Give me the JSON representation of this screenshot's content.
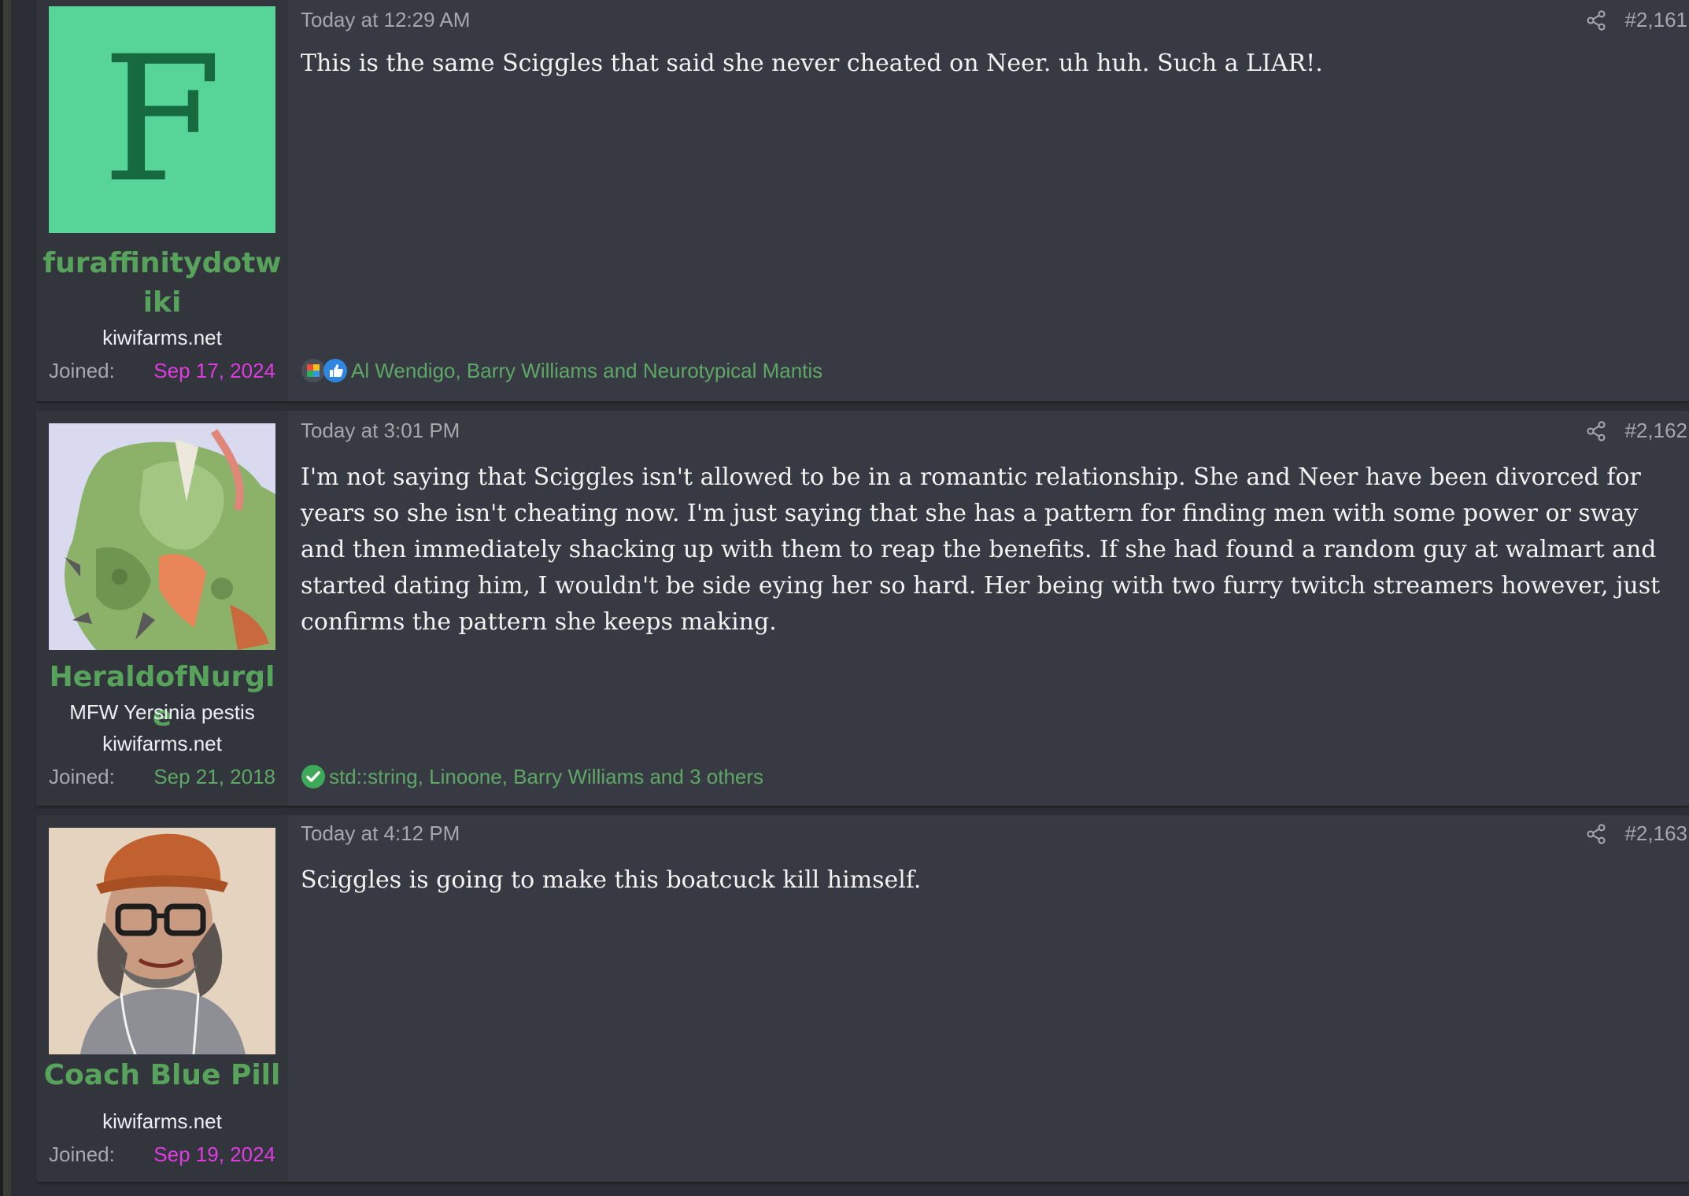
{
  "posts": [
    {
      "username": "furaffinitydotwiki",
      "avatar_letter": "F",
      "user_title": "",
      "site": "kiwifarms.net",
      "joined_label": "Joined:",
      "joined_date": "Sep 17, 2024",
      "joined_date_color": "#e03be0",
      "post_date": "Today at 12:29 AM",
      "post_number": "#2,161",
      "body": "This is the same Sciggles that said she never cheated on Neer. uh huh. Such a LIAR!.",
      "reactions_text": "Al Wendigo, Barry Williams and Neurotypical Mantis",
      "reaction_icons": [
        "puzzle-icon",
        "thumbs-up-icon"
      ]
    },
    {
      "username": "HeraldofNurgle",
      "user_title": "MFW Yersinia pestis",
      "site": "kiwifarms.net",
      "joined_label": "Joined:",
      "joined_date": "Sep 21, 2018",
      "joined_date_color": "#5fa766",
      "post_date": "Today at 3:01 PM",
      "post_number": "#2,162",
      "body": "I'm not saying that Sciggles isn't allowed to be in a romantic relationship. She and Neer have been divorced for years so she isn't cheating now. I'm just saying that she has a pattern for finding men with some power or sway and then immediately shacking up with them to reap the benefits. If she had found a random guy at walmart and started dating him, I wouldn't be side eying her so hard. Her being with two furry twitch streamers however, just confirms the pattern she keeps making.",
      "reactions_text": "std::string, Linoone, Barry Williams and 3 others",
      "reaction_icons": [
        "checkmark-icon"
      ]
    },
    {
      "username": "Coach Blue Pill",
      "user_title": "",
      "site": "kiwifarms.net",
      "joined_label": "Joined:",
      "joined_date": "Sep 19, 2024",
      "joined_date_color": "#e03be0",
      "post_date": "Today at 4:12 PM",
      "post_number": "#2,163",
      "body": "Sciggles is going to make this boatcuck kill himself.",
      "reactions_text": "",
      "reaction_icons": []
    }
  ],
  "colors": {
    "username": "#58a35c",
    "reaction_link": "#5fa766",
    "new_user_date": "#e03be0",
    "post_bg": "#373a42",
    "page_bg": "#2b2e34"
  }
}
